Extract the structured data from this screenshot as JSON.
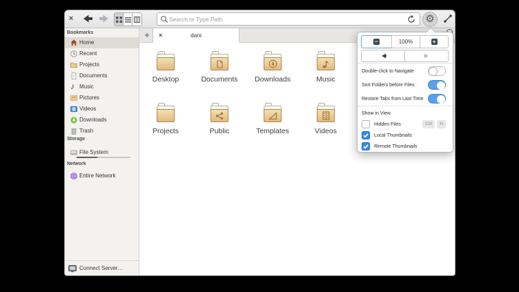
{
  "toolbar": {
    "close_label": "×",
    "search_placeholder": "Search or Type Path"
  },
  "tabbar": {
    "new_tab_label": "+",
    "tabs": [
      {
        "title": "dani",
        "close_label": "×"
      }
    ]
  },
  "sidebar": {
    "sections": [
      {
        "header": "Bookmarks",
        "items": [
          {
            "label": "Home",
            "selected": true
          },
          {
            "label": "Recent"
          },
          {
            "label": "Projects"
          },
          {
            "label": "Documents"
          },
          {
            "label": "Music"
          },
          {
            "label": "Pictures"
          },
          {
            "label": "Videos"
          },
          {
            "label": "Downloads"
          },
          {
            "label": "Trash"
          }
        ]
      },
      {
        "header": "Storage",
        "items": [
          {
            "label": "File System"
          }
        ]
      },
      {
        "header": "Network",
        "items": [
          {
            "label": "Entire Network"
          }
        ]
      }
    ],
    "connect_server": "Connect Server…"
  },
  "files": [
    {
      "name": "Desktop"
    },
    {
      "name": "Documents"
    },
    {
      "name": "Downloads"
    },
    {
      "name": "Music"
    },
    {
      "name": "Projects"
    },
    {
      "name": "Public"
    },
    {
      "name": "Templates"
    },
    {
      "name": "Videos"
    }
  ],
  "popover": {
    "zoom_out_label": "−",
    "zoom_level": "100%",
    "zoom_in_label": "+",
    "toggles": [
      {
        "label": "Double-click to Navigate",
        "on": false
      },
      {
        "label": "Sort Folders before Files",
        "on": true
      },
      {
        "label": "Restore Tabs from Last Time",
        "on": true
      }
    ],
    "section_header": "Show in View",
    "checks": [
      {
        "label": "Hidden Files",
        "checked": false,
        "shortcut": [
          "Ctrl",
          "H"
        ]
      },
      {
        "label": "Local Thumbnails",
        "checked": true
      },
      {
        "label": "Remote Thumbnails",
        "checked": true
      }
    ]
  },
  "colors": {
    "accent": "#3689e6",
    "folder_body": "#e6bd7d",
    "toggle_on": "#59a1e8"
  }
}
